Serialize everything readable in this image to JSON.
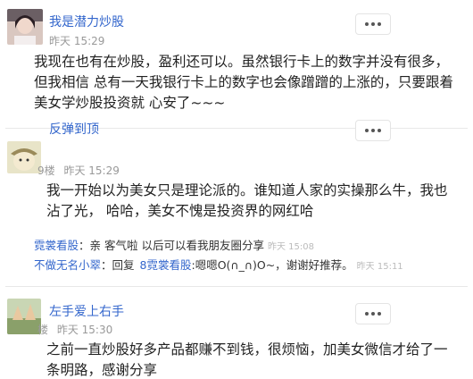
{
  "posts": [
    {
      "username": "我是潜力炒股",
      "floor": "",
      "time": "昨天 15:29",
      "lines": [
        "我现在也有在炒股，盈利还可以。虽然银行卡上的数字并没有很多，",
        "但我相信 总有一天我银行卡上的数字也会像蹭蹭的上涨的，只要跟着",
        "美女学炒股投资就 心安了~~~"
      ]
    },
    {
      "username": "反弹到顶",
      "floor": "9楼",
      "time": "昨天 15:29",
      "lines": [
        "我一开始以为美女只是理论派的。谁知道人家的实操那么牛，我也",
        "沾了光， 哈哈，美女不愧是投资界的网红哈"
      ],
      "replies": [
        {
          "name": "霓裳看股",
          "sep": "：",
          "text": "亲 客气啦 以后可以看我朋友圈分享",
          "time": "昨天 15:08"
        },
        {
          "name": "不做无名小翠",
          "sep": "：",
          "prefix": "回复",
          "target": "8霓裳看股",
          "text": ":嗯嗯O(∩_∩)O~，谢谢好推荐。",
          "time": "昨天 15:11"
        }
      ]
    },
    {
      "username": "左手爱上右手",
      "floor": "楼",
      "time": "昨天 15:30",
      "lines": [
        "之前一直炒股好多产品都赚不到钱，很烦恼，加美女微信才给了一",
        "条明路，感谢分享"
      ]
    }
  ],
  "icons": {
    "more": "more-horizontal-icon",
    "avatar": "user-avatar-icon"
  },
  "colors": {
    "username": "#3366cc",
    "meta": "#999999",
    "text": "#222222",
    "separator": "#e8e8e8"
  }
}
